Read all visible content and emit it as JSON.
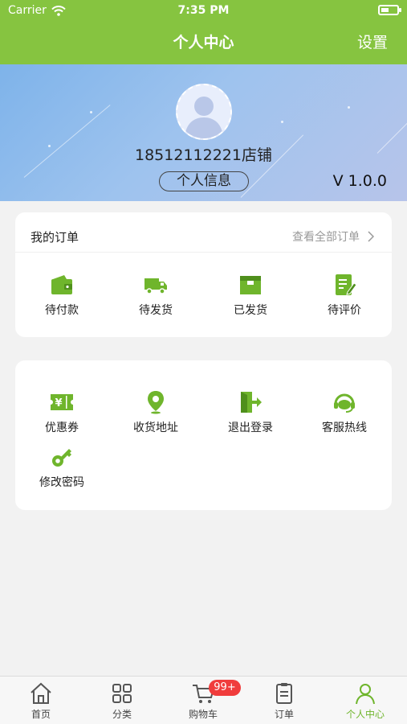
{
  "status_bar": {
    "carrier": "Carrier",
    "time": "7:35 PM"
  },
  "nav": {
    "title": "个人中心",
    "settings_label": "设置"
  },
  "profile": {
    "shop_name": "18512112221店铺",
    "info_button": "个人信息",
    "version": "V 1.0.0"
  },
  "orders": {
    "title": "我的订单",
    "view_all": "查看全部订单",
    "items": [
      {
        "label": "待付款",
        "icon": "wallet-icon"
      },
      {
        "label": "待发货",
        "icon": "truck-icon"
      },
      {
        "label": "已发货",
        "icon": "box-icon"
      },
      {
        "label": "待评价",
        "icon": "review-icon"
      }
    ]
  },
  "services": {
    "items": [
      {
        "label": "优惠券",
        "icon": "coupon-icon"
      },
      {
        "label": "收货地址",
        "icon": "location-pin-icon"
      },
      {
        "label": "退出登录",
        "icon": "logout-icon"
      },
      {
        "label": "客服热线",
        "icon": "headset-icon"
      },
      {
        "label": "修改密码",
        "icon": "key-icon"
      }
    ]
  },
  "tabbar": {
    "items": [
      {
        "label": "首页",
        "icon": "home-icon"
      },
      {
        "label": "分类",
        "icon": "category-grid-icon"
      },
      {
        "label": "购物车",
        "icon": "cart-icon",
        "badge": "99+"
      },
      {
        "label": "订单",
        "icon": "order-list-icon"
      },
      {
        "label": "个人中心",
        "icon": "user-icon",
        "active": true
      }
    ]
  },
  "colors": {
    "brand_green": "#86c440",
    "icon_green": "#6fb52c",
    "badge_red": "#f03c3c"
  }
}
